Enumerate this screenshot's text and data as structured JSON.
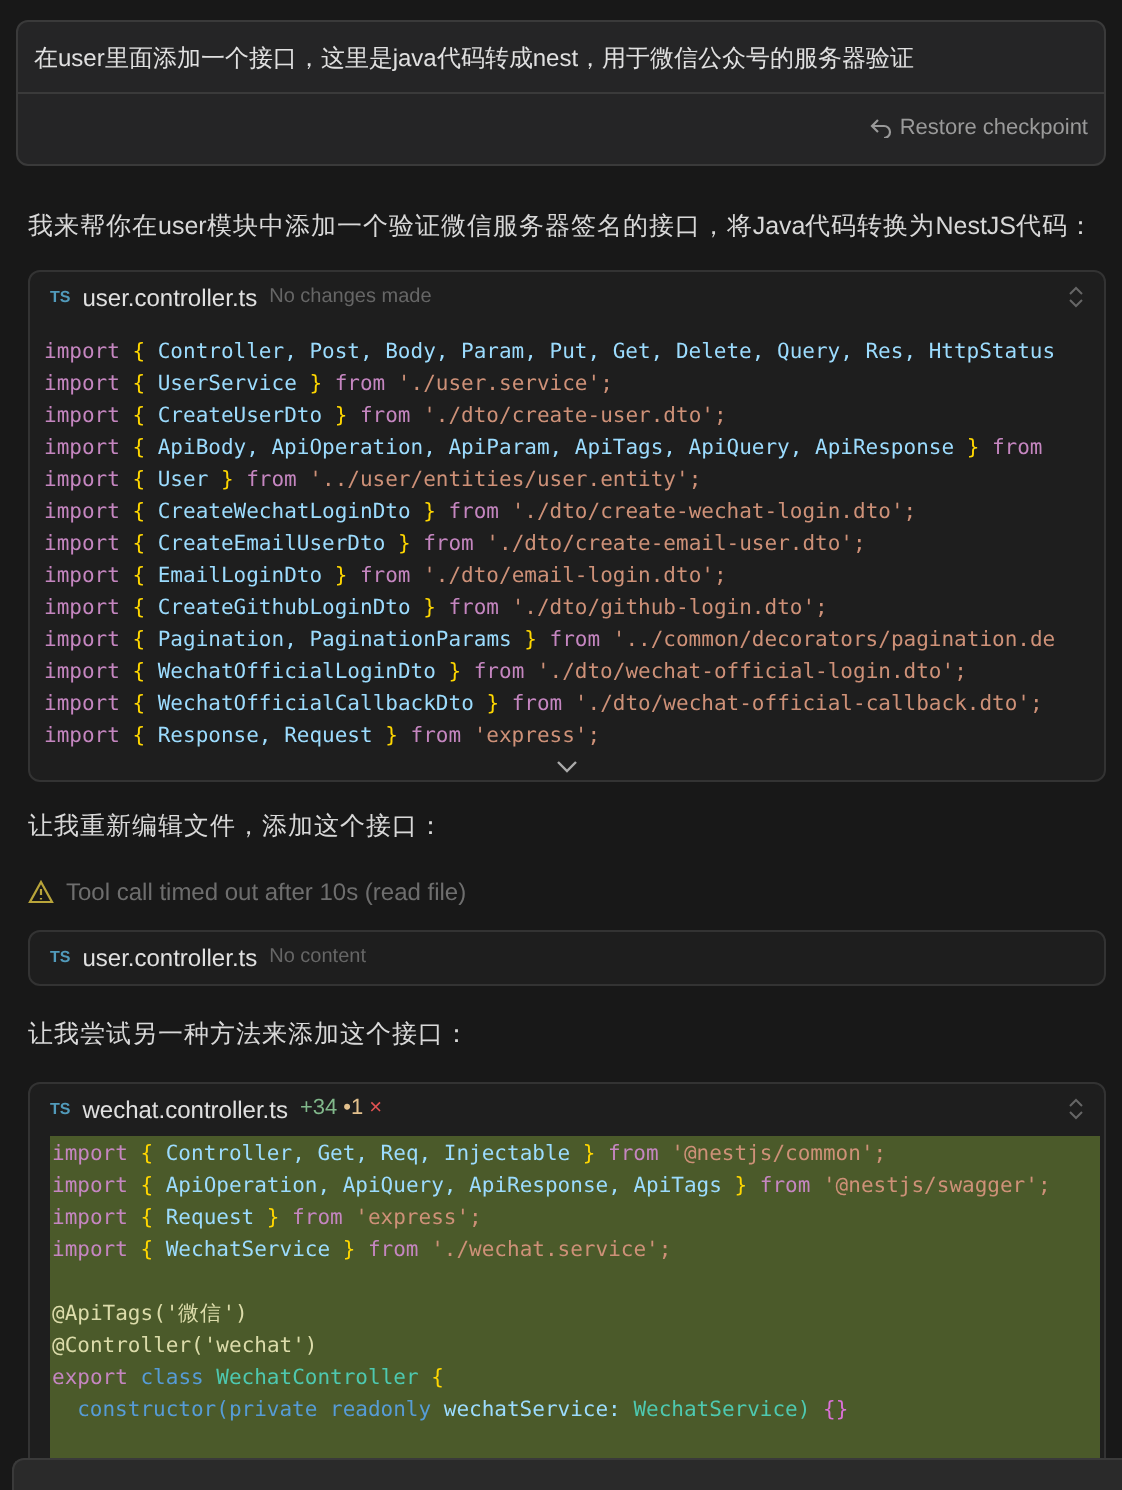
{
  "user_message": {
    "text": "在user里面添加一个接口，这里是java代码转成nest，用于微信公众号的服务器验证",
    "restore_label": "Restore checkpoint"
  },
  "reply_intro": "我来帮你在user模块中添加一个验证微信服务器签名的接口，将Java代码转换为NestJS代码：",
  "file_card_1": {
    "badge": "TS",
    "filename": "user.controller.ts",
    "status": "No changes made",
    "code": [
      {
        "tokens": [
          {
            "kind": "kw",
            "text": "import"
          },
          {
            "kind": "p",
            "text": "{"
          },
          {
            "kind": "id",
            "text": "Controller,"
          },
          {
            "kind": "id",
            "text": "Post,"
          },
          {
            "kind": "id",
            "text": "Body,"
          },
          {
            "kind": "id",
            "text": "Param,"
          },
          {
            "kind": "id",
            "text": "Put,"
          },
          {
            "kind": "id",
            "text": "Get,"
          },
          {
            "kind": "id",
            "text": "Delete,"
          },
          {
            "kind": "id",
            "text": "Query,"
          },
          {
            "kind": "id",
            "text": "Res,"
          },
          {
            "kind": "id",
            "text": "HttpStatus"
          }
        ]
      },
      {
        "tokens": [
          {
            "kind": "kw",
            "text": "import"
          },
          {
            "kind": "p",
            "text": "{"
          },
          {
            "kind": "id",
            "text": "UserService"
          },
          {
            "kind": "p",
            "text": "}"
          },
          {
            "kind": "kw",
            "text": "from"
          },
          {
            "kind": "s",
            "text": "'./user.service';"
          }
        ]
      },
      {
        "tokens": [
          {
            "kind": "kw",
            "text": "import"
          },
          {
            "kind": "p",
            "text": "{"
          },
          {
            "kind": "id",
            "text": "CreateUserDto"
          },
          {
            "kind": "p",
            "text": "}"
          },
          {
            "kind": "kw",
            "text": "from"
          },
          {
            "kind": "s",
            "text": "'./dto/create-user.dto';"
          }
        ]
      },
      {
        "tokens": [
          {
            "kind": "kw",
            "text": "import"
          },
          {
            "kind": "p",
            "text": "{"
          },
          {
            "kind": "id",
            "text": "ApiBody,"
          },
          {
            "kind": "id",
            "text": "ApiOperation,"
          },
          {
            "kind": "id",
            "text": "ApiParam,"
          },
          {
            "kind": "id",
            "text": "ApiTags,"
          },
          {
            "kind": "id",
            "text": "ApiQuery,"
          },
          {
            "kind": "id",
            "text": "ApiResponse"
          },
          {
            "kind": "p",
            "text": "}"
          },
          {
            "kind": "kw",
            "text": "from"
          }
        ]
      },
      {
        "tokens": [
          {
            "kind": "kw",
            "text": "import"
          },
          {
            "kind": "p",
            "text": "{"
          },
          {
            "kind": "id",
            "text": "User"
          },
          {
            "kind": "p",
            "text": "}"
          },
          {
            "kind": "kw",
            "text": "from"
          },
          {
            "kind": "s",
            "text": "'../user/entities/user.entity';"
          }
        ]
      },
      {
        "tokens": [
          {
            "kind": "kw",
            "text": "import"
          },
          {
            "kind": "p",
            "text": "{"
          },
          {
            "kind": "id",
            "text": "CreateWechatLoginDto"
          },
          {
            "kind": "p",
            "text": "}"
          },
          {
            "kind": "kw",
            "text": "from"
          },
          {
            "kind": "s",
            "text": "'./dto/create-wechat-login.dto';"
          }
        ]
      },
      {
        "tokens": [
          {
            "kind": "kw",
            "text": "import"
          },
          {
            "kind": "p",
            "text": "{"
          },
          {
            "kind": "id",
            "text": "CreateEmailUserDto"
          },
          {
            "kind": "p",
            "text": "}"
          },
          {
            "kind": "kw",
            "text": "from"
          },
          {
            "kind": "s",
            "text": "'./dto/create-email-user.dto';"
          }
        ]
      },
      {
        "tokens": [
          {
            "kind": "kw",
            "text": "import"
          },
          {
            "kind": "p",
            "text": "{"
          },
          {
            "kind": "id",
            "text": "EmailLoginDto"
          },
          {
            "kind": "p",
            "text": "}"
          },
          {
            "kind": "kw",
            "text": "from"
          },
          {
            "kind": "s",
            "text": "'./dto/email-login.dto';"
          }
        ]
      },
      {
        "tokens": [
          {
            "kind": "kw",
            "text": "import"
          },
          {
            "kind": "p",
            "text": "{"
          },
          {
            "kind": "id",
            "text": "CreateGithubLoginDto"
          },
          {
            "kind": "p",
            "text": "}"
          },
          {
            "kind": "kw",
            "text": "from"
          },
          {
            "kind": "s",
            "text": "'./dto/github-login.dto';"
          }
        ]
      },
      {
        "tokens": [
          {
            "kind": "kw",
            "text": "import"
          },
          {
            "kind": "p",
            "text": "{"
          },
          {
            "kind": "id",
            "text": "Pagination,"
          },
          {
            "kind": "id",
            "text": "PaginationParams"
          },
          {
            "kind": "p",
            "text": "}"
          },
          {
            "kind": "kw",
            "text": "from"
          },
          {
            "kind": "s",
            "text": "'../common/decorators/pagination.de"
          }
        ]
      },
      {
        "tokens": [
          {
            "kind": "kw",
            "text": "import"
          },
          {
            "kind": "p",
            "text": "{"
          },
          {
            "kind": "id",
            "text": "WechatOfficialLoginDto"
          },
          {
            "kind": "p",
            "text": "}"
          },
          {
            "kind": "kw",
            "text": "from"
          },
          {
            "kind": "s",
            "text": "'./dto/wechat-official-login.dto';"
          }
        ]
      },
      {
        "tokens": [
          {
            "kind": "kw",
            "text": "import"
          },
          {
            "kind": "p",
            "text": "{"
          },
          {
            "kind": "id",
            "text": "WechatOfficialCallbackDto"
          },
          {
            "kind": "p",
            "text": "}"
          },
          {
            "kind": "kw",
            "text": "from"
          },
          {
            "kind": "s",
            "text": "'./dto/wechat-official-callback.dto';"
          }
        ]
      },
      {
        "tokens": [
          {
            "kind": "kw",
            "text": "import"
          },
          {
            "kind": "p",
            "text": "{"
          },
          {
            "kind": "id",
            "text": "Response,"
          },
          {
            "kind": "id",
            "text": "Request"
          },
          {
            "kind": "p",
            "text": "}"
          },
          {
            "kind": "kw",
            "text": "from"
          },
          {
            "kind": "s",
            "text": "'express';"
          }
        ]
      }
    ]
  },
  "text_2": "让我重新编辑文件，添加这个接口：",
  "warning": "Tool call timed out after 10s (read file)",
  "file_card_2": {
    "badge": "TS",
    "filename": "user.controller.ts",
    "status": "No content"
  },
  "text_3": "让我尝试另一种方法来添加这个接口：",
  "file_card_3": {
    "badge": "TS",
    "filename": "wechat.controller.ts",
    "added": "+34",
    "modified": "•1",
    "rejected": "×",
    "code": [
      {
        "tokens": [
          {
            "kind": "kw",
            "text": "import"
          },
          {
            "kind": "p",
            "text": "{"
          },
          {
            "kind": "id",
            "text": "Controller,"
          },
          {
            "kind": "id",
            "text": "Get,"
          },
          {
            "kind": "id",
            "text": "Req,"
          },
          {
            "kind": "id",
            "text": "Injectable"
          },
          {
            "kind": "p",
            "text": "}"
          },
          {
            "kind": "kw",
            "text": "from"
          },
          {
            "kind": "s",
            "text": "'@nestjs/common';"
          }
        ]
      },
      {
        "tokens": [
          {
            "kind": "kw",
            "text": "import"
          },
          {
            "kind": "p",
            "text": "{"
          },
          {
            "kind": "id",
            "text": "ApiOperation,"
          },
          {
            "kind": "id",
            "text": "ApiQuery,"
          },
          {
            "kind": "id",
            "text": "ApiResponse,"
          },
          {
            "kind": "id",
            "text": "ApiTags"
          },
          {
            "kind": "p",
            "text": "}"
          },
          {
            "kind": "kw",
            "text": "from"
          },
          {
            "kind": "s",
            "text": "'@nestjs/swagger';"
          }
        ]
      },
      {
        "tokens": [
          {
            "kind": "kw",
            "text": "import"
          },
          {
            "kind": "p",
            "text": "{"
          },
          {
            "kind": "id",
            "text": "Request"
          },
          {
            "kind": "p",
            "text": "}"
          },
          {
            "kind": "kw",
            "text": "from"
          },
          {
            "kind": "s",
            "text": "'express';"
          }
        ]
      },
      {
        "tokens": [
          {
            "kind": "kw",
            "text": "import"
          },
          {
            "kind": "p",
            "text": "{"
          },
          {
            "kind": "id",
            "text": "WechatService"
          },
          {
            "kind": "p",
            "text": "}"
          },
          {
            "kind": "kw",
            "text": "from"
          },
          {
            "kind": "s",
            "text": "'./wechat.service';"
          }
        ]
      },
      {
        "gap_before": true,
        "tokens": [
          {
            "kind": "dec",
            "text": "@ApiTags('微信')"
          }
        ]
      },
      {
        "tokens": [
          {
            "kind": "dec",
            "text": "@Controller('wechat')"
          }
        ]
      },
      {
        "tokens": [
          {
            "kind": "kw",
            "text": "export"
          },
          {
            "kind": "bl",
            "text": "class"
          },
          {
            "kind": "cls",
            "text": "WechatController"
          },
          {
            "kind": "p",
            "text": "{"
          }
        ]
      },
      {
        "indent": true,
        "tokens": [
          {
            "kind": "bl",
            "text": "constructor(private"
          },
          {
            "kind": "bl",
            "text": "readonly"
          },
          {
            "kind": "id",
            "text": "wechatService:"
          },
          {
            "kind": "cls",
            "text": "WechatService)"
          },
          {
            "kind": "m",
            "text": "{}"
          }
        ]
      }
    ]
  }
}
